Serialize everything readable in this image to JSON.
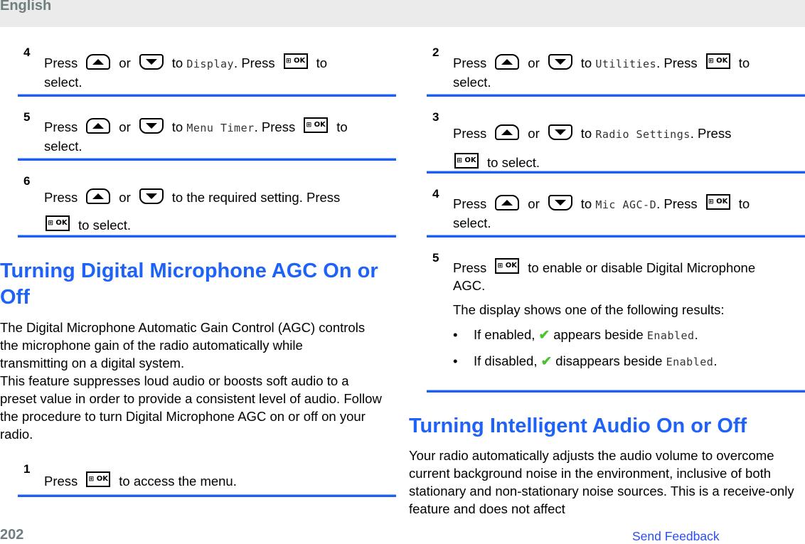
{
  "header": {
    "language": "English"
  },
  "left": {
    "steps_top": [
      {
        "num": "4",
        "parts": [
          "Press",
          "up",
          "or",
          "down",
          "to",
          "Display",
          ". Press",
          "ok",
          "to select."
        ],
        "pre": "Press",
        "mid": "or",
        "to": "to",
        "menu": "Display",
        "press2": ". Press",
        "after": "to",
        "line2": "select."
      },
      {
        "num": "5",
        "pre": "Press",
        "mid": "or",
        "to": "to",
        "menu": "Menu Timer",
        "press2": ". Press",
        "after": "to",
        "line2": "select."
      },
      {
        "num": "6",
        "pre": "Press",
        "mid": "or",
        "to": "to the required setting. Press",
        "line2": "to select."
      }
    ],
    "section_title": "Turning Digital Microphone AGC On or Off",
    "paragraphs": [
      "The Digital Microphone Automatic Gain Control (AGC) controls the microphone gain of the radio automatically while transmitting on a digital system.",
      "This feature suppresses loud audio or boosts soft audio to a preset value in order to provide a consistent level of audio. Follow the procedure to turn Digital Microphone AGC on or off on your radio."
    ],
    "step1": {
      "num": "1",
      "pre": "Press",
      "after": "to access the menu."
    }
  },
  "right": {
    "steps": [
      {
        "num": "2",
        "pre": "Press",
        "mid": "or",
        "to": "to",
        "menu": "Utilities",
        "press2": ". Press",
        "after": "to",
        "line2": "select."
      },
      {
        "num": "3",
        "pre": "Press",
        "mid": "or",
        "to": "to",
        "menu": "Radio Settings",
        "press2": ". Press",
        "line2": "to select."
      },
      {
        "num": "4",
        "pre": "Press",
        "mid": "or",
        "to": "to",
        "menu": "Mic AGC-D",
        "press2": ". Press",
        "after": "to",
        "line2": "select."
      },
      {
        "num": "5",
        "pre": "Press",
        "after": "to enable or disable Digital Microphone",
        "line2": "AGC.",
        "result_intro": "The display shows one of the following results:",
        "results": [
          {
            "pre": "If enabled,",
            "post": "appears beside",
            "menu": "Enabled",
            "end": "."
          },
          {
            "pre": "If disabled,",
            "post": "disappears beside",
            "menu": "Enabled",
            "end": "."
          }
        ]
      }
    ],
    "section_title": "Turning Intelligent Audio On or Off",
    "paragraph": "Your radio automatically adjusts the audio volume to overcome current background noise in the environment, inclusive of both stationary and non-stationary noise sources. This is a receive-only feature and does not affect"
  },
  "icons": {
    "up": "up-arrow-key-icon",
    "down": "down-arrow-key-icon",
    "ok": "menu-ok-key-icon",
    "ok_label": "OK",
    "ok_grid": "⊞",
    "check": "✔"
  },
  "footer": {
    "page_number": "202",
    "feedback_link": "Send Feedback"
  },
  "colors": {
    "accent": "#1f62f7",
    "divider": "#1f5ef5",
    "check": "#4cc22e",
    "muted": "#6f7f7f"
  }
}
